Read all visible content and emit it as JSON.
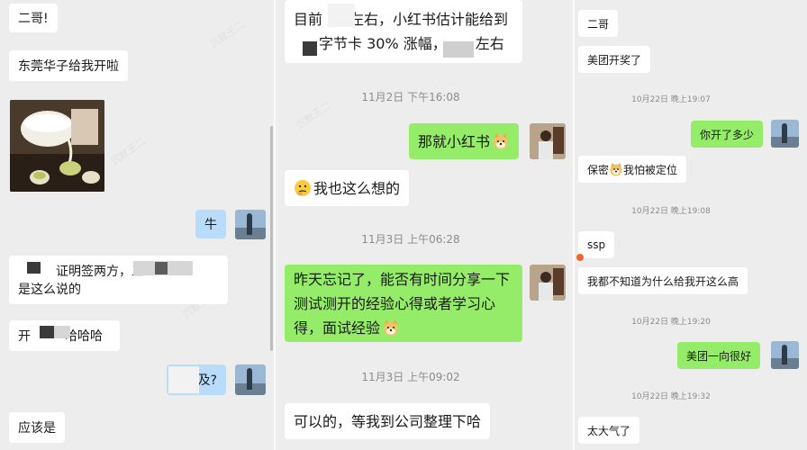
{
  "left_chat": {
    "messages": [
      {
        "text": "二哥!"
      },
      {
        "text": "东莞华子给我开啦"
      },
      {
        "image": "tea-pouring-photo"
      },
      {
        "text": "牛"
      },
      {
        "line1": "证明签两方，三",
        "line2": "是这么说的"
      },
      {
        "text_a": "开",
        "text_b": "哈哈哈"
      },
      {
        "text": "及?"
      },
      {
        "text": "应该是"
      }
    ]
  },
  "middle_chat": {
    "top_bubble": {
      "line1_a": "目前",
      "line1_b": "左右，小红书估计能给到",
      "line2_a": "字节卡 30% 涨幅，",
      "line2_b": "左右"
    },
    "timestamps": [
      "11月2日 下午16:08",
      "11月3日 上午06:28",
      "11月3日 上午09:02"
    ],
    "messages": [
      {
        "text": "那就小红书",
        "emoji": "doge-emoji"
      },
      {
        "text": "我也这么想的",
        "emoji": "thinking-emoji"
      },
      {
        "line1": "昨天忘记了，能否有时间分享一下",
        "line2": "测试测开的经验心得或者学习心",
        "line3": "得，面试经验",
        "emoji": "doge-emoji"
      },
      {
        "text": "可以的，等我到公司整理下哈"
      }
    ]
  },
  "right_chat": {
    "timestamps": [
      "10月22日 晚上19:07",
      "10月22日 晚上19:08",
      "10月22日 晚上19:20",
      "10月22日 晚上19:32"
    ],
    "messages": [
      {
        "text": "二哥"
      },
      {
        "text": "美团开奖了"
      },
      {
        "text": "你开了多少"
      },
      {
        "text_a": "保密",
        "text_b": "我怕被定位",
        "emoji": "doge-emoji"
      },
      {
        "text": "ssp"
      },
      {
        "text": "我都不知道为什么给我开这么高"
      },
      {
        "text": "美团一向很好"
      },
      {
        "text": "太大气了"
      }
    ]
  },
  "colors": {
    "bg": "#ededed",
    "bubble_in": "#ffffff",
    "bubble_out": "#95ec69",
    "bubble_blue": "#b9dcfb",
    "timestamp": "#8c8c8c"
  },
  "watermark": "沉默王二"
}
